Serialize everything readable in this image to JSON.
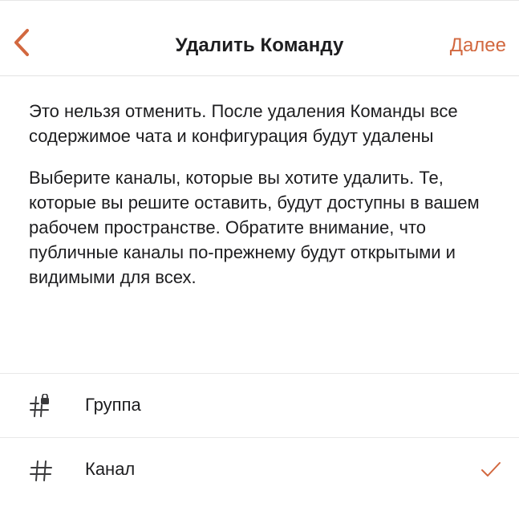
{
  "header": {
    "title": "Удалить Команду",
    "next_label": "Далее",
    "back_icon": "chevron-left-icon"
  },
  "body": {
    "warning": "Это нельзя отменить. После удаления Команды все содержимое чата и конфигурация будут удалены",
    "instructions": "Выберите каналы, которые вы хотите удалить. Те, которые вы решите оставить, будут доступны в вашем рабочем пространстве. Обратите внимание, что публичные каналы по-прежнему будут открытыми и видимыми для всех."
  },
  "channels": [
    {
      "label": "Группа",
      "icon": "private-channel-icon",
      "selected": false
    },
    {
      "label": "Канал",
      "icon": "hash-icon",
      "selected": true
    }
  ],
  "colors": {
    "accent": "#d2683f",
    "text": "#1d1d1f",
    "icon": "#3a3a3c",
    "divider": "#e8e8e8"
  }
}
